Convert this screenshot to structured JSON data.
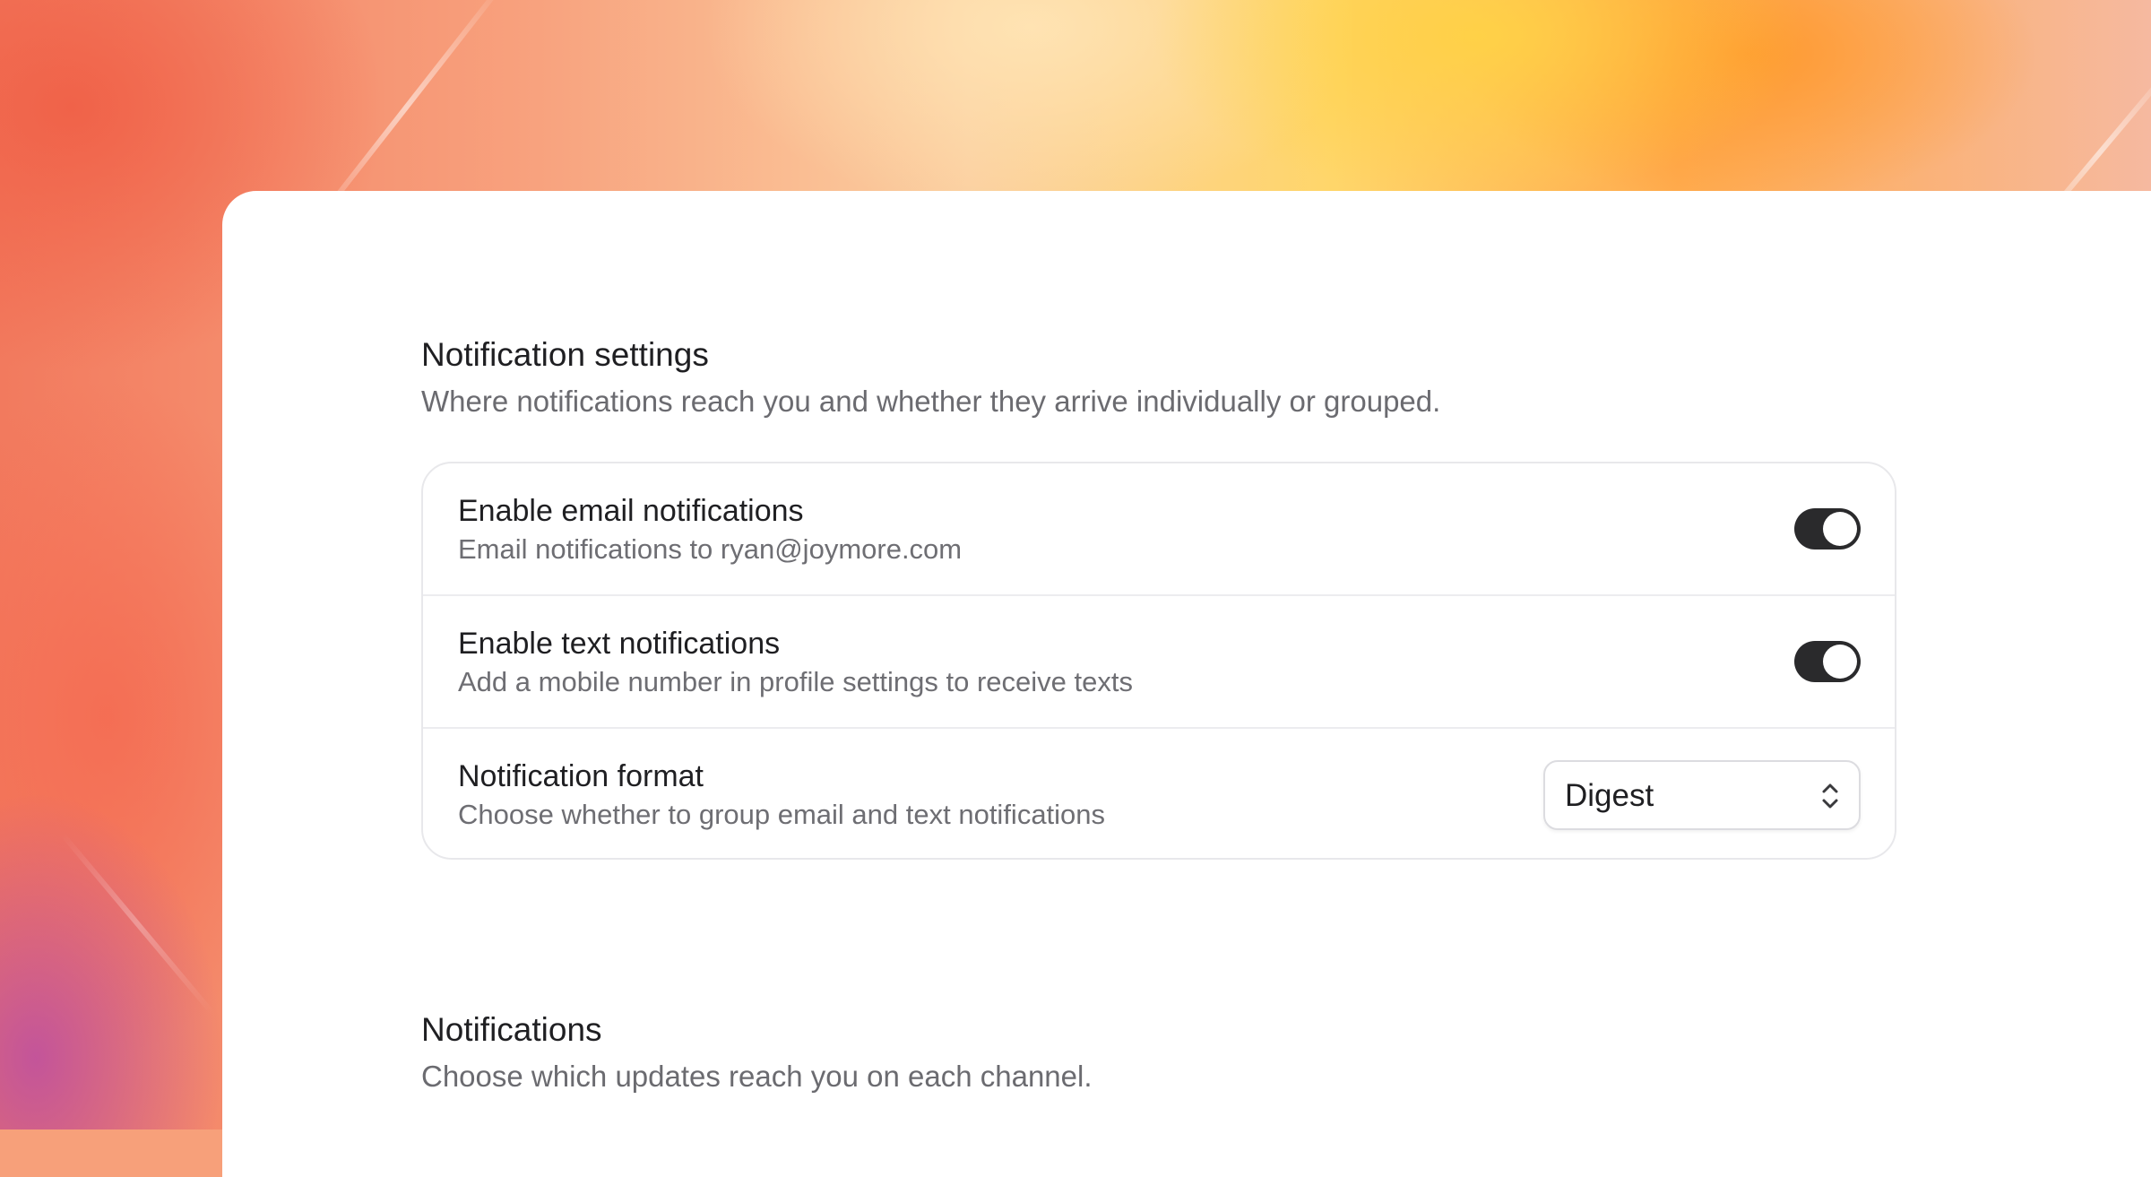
{
  "notification_settings": {
    "title": "Notification settings",
    "description": "Where notifications reach you and whether they arrive individually or grouped.",
    "rows": [
      {
        "title": "Enable email notifications",
        "subtitle": "Email notifications to ryan@joymore.com",
        "control": "toggle",
        "enabled": true
      },
      {
        "title": "Enable text notifications",
        "subtitle": "Add a mobile number in profile settings to receive texts",
        "control": "toggle",
        "enabled": true
      },
      {
        "title": "Notification format",
        "subtitle": "Choose whether to group email and text notifications",
        "control": "select",
        "selected": "Digest",
        "icon": "chevron-up-down-icon"
      }
    ]
  },
  "notifications": {
    "title": "Notifications",
    "description": "Choose which updates reach you on each channel."
  },
  "colors": {
    "toggle_on": "#2a2a2c",
    "panel_bg": "#ffffff",
    "title_text": "#1f1f22",
    "secondary_text": "#6b6b70"
  }
}
